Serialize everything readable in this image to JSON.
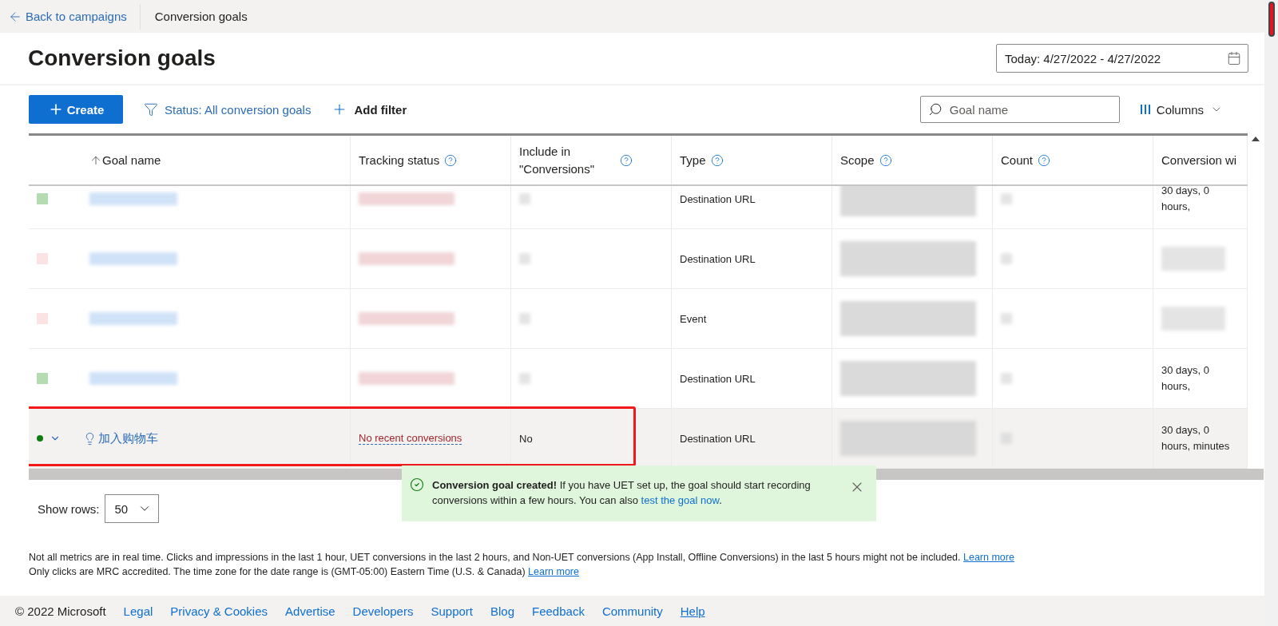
{
  "nav": {
    "back": "Back to campaigns",
    "current": "Conversion goals"
  },
  "title": "Conversion goals",
  "date_range": "Today: 4/27/2022 - 4/27/2022",
  "toolbar": {
    "create": "Create",
    "status_filter": "Status: All conversion goals",
    "add_filter": "Add filter",
    "search": {
      "placeholder": "Goal name"
    },
    "columns": "Columns"
  },
  "table": {
    "columns": [
      {
        "label": "Goal name",
        "sorted": true,
        "help": false
      },
      {
        "label": "Tracking status",
        "sorted": false,
        "help": true
      },
      {
        "label": "Include in \"Conversions\"",
        "sorted": false,
        "help": true
      },
      {
        "label": "Type",
        "sorted": false,
        "help": true
      },
      {
        "label": "Scope",
        "sorted": false,
        "help": true
      },
      {
        "label": "Count",
        "sorted": false,
        "help": true
      },
      {
        "label": "Conversion wi",
        "sorted": false,
        "help": false
      }
    ],
    "rows": [
      {
        "kind": "redacted",
        "color": "#b5dbb2",
        "type": "Destination URL",
        "window": "30 days, 0 hours,"
      },
      {
        "kind": "redacted",
        "color": "#fbe3e3",
        "type": "Destination URL"
      },
      {
        "kind": "redacted",
        "color": "#fbe3e3",
        "type": "Event"
      },
      {
        "kind": "redacted",
        "color": "#b5dbb2",
        "type": "Destination URL",
        "window": "30 days, 0 hours,"
      },
      {
        "kind": "goal",
        "color": "#107c10",
        "name": "加入购物车",
        "tracking_status": "No recent conversions",
        "include": "No",
        "type": "Destination URL",
        "window": "30 days, 0 hours, minutes",
        "highlighted": true
      }
    ]
  },
  "show_rows": {
    "label": "Show rows:",
    "value": "50"
  },
  "toast": {
    "message": "**Conversion goal created!** If you have UET set up, the goal should start recording conversions within a few hours. You can also ",
    "link": "test the goal now",
    "end": "."
  },
  "notes": [
    {
      "text": "Not all metrics are in real time. Clicks and impressions in the last 1 hour, UET conversions in the last 2 hours, and Non-UET conversions (App Install, Offline Conversions) in the last 5 hours might not be included. ",
      "link": "Learn more"
    },
    {
      "text": "Only clicks are MRC accredited. The time zone for the date range is (GMT-05:00) Eastern Time (U.S. & Canada) ",
      "link": "Learn more"
    }
  ],
  "footer": {
    "copyright": "© 2022 Microsoft",
    "links": [
      {
        "label": "Legal",
        "underlined": false
      },
      {
        "label": "Privacy & Cookies",
        "underlined": false
      },
      {
        "label": "Advertise",
        "underlined": false
      },
      {
        "label": "Developers",
        "underlined": false
      },
      {
        "label": "Support",
        "underlined": false
      },
      {
        "label": "Blog",
        "underlined": false
      },
      {
        "label": "Feedback",
        "underlined": false
      },
      {
        "label": "Community",
        "underlined": false
      },
      {
        "label": "Help",
        "underlined": true
      }
    ]
  }
}
